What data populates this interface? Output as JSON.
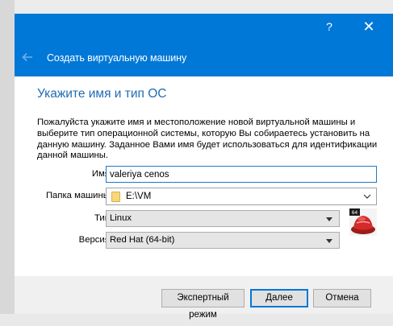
{
  "window": {
    "help_label": "?",
    "close_label": "✕",
    "back_icon": "arrow-left-icon",
    "title": "Создать виртуальную машину"
  },
  "page": {
    "heading": "Укажите имя и тип ОС",
    "description": "Пожалуйста укажите имя и местоположение новой виртуальной машины и выберите тип операционной системы, которую Вы собираетесь установить на данную машину. Заданное Вами имя будет использоваться для идентификации данной машины."
  },
  "form": {
    "name_label": "Имя:",
    "name_value": "valeriya cenos",
    "folder_label": "Папка машины:",
    "folder_value": "E:\\VM",
    "type_label": "Тип:",
    "type_value": "Linux",
    "version_label": "Версия:",
    "version_value": "Red Hat (64-bit)",
    "os_badge": "64",
    "os_icon": "redhat-icon"
  },
  "buttons": {
    "expert": "Экспертный режим",
    "next": "Далее",
    "cancel": "Отмена"
  },
  "colors": {
    "accent": "#0078d7",
    "heading": "#1f6bb5"
  }
}
